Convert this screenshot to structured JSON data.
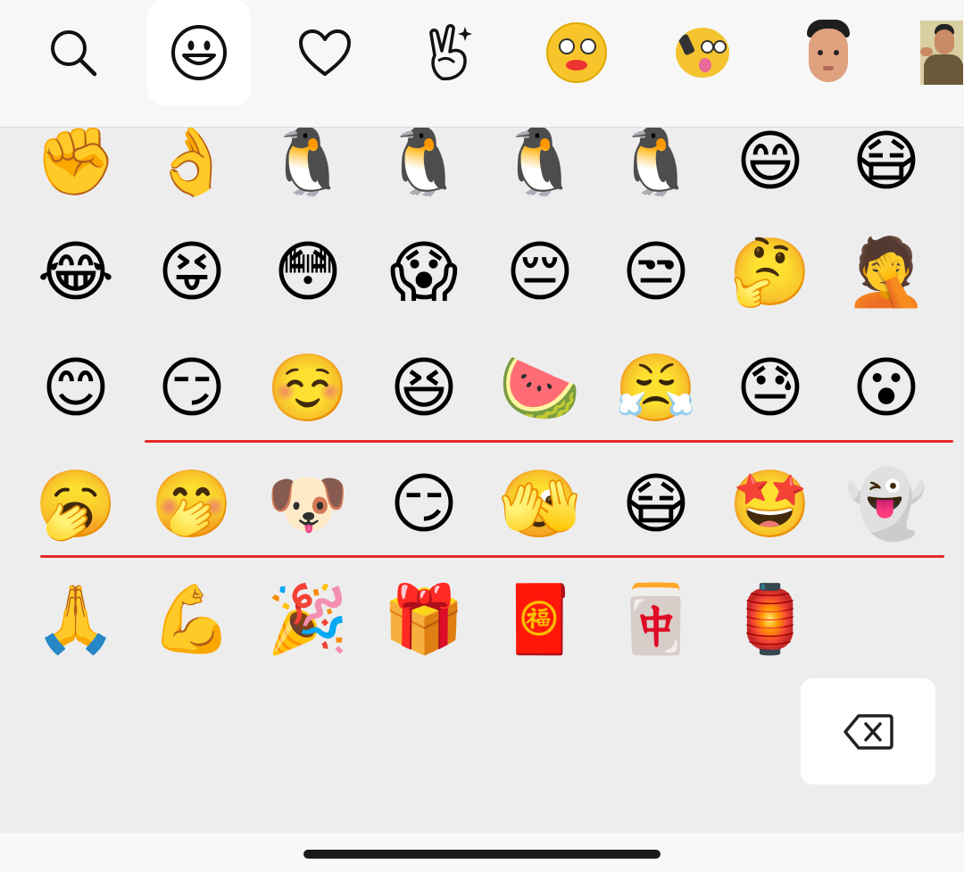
{
  "tabs": [
    {
      "name": "search-tab",
      "icon": "search-icon"
    },
    {
      "name": "emoji-tab",
      "icon": "smiley-icon",
      "active": true
    },
    {
      "name": "favorites-tab",
      "icon": "heart-icon"
    },
    {
      "name": "gesture-tab",
      "icon": "victory-hand-icon"
    },
    {
      "name": "sticker-pack-1-tab",
      "icon": "yellow-face-sticker-icon"
    },
    {
      "name": "sticker-pack-2-tab",
      "icon": "phone-face-sticker-icon"
    },
    {
      "name": "sticker-pack-3-tab",
      "icon": "man-photo-sticker-icon"
    },
    {
      "name": "sticker-pack-4-tab",
      "icon": "man-photo-sticker-icon"
    }
  ],
  "emoji_rows": [
    [
      "✊",
      "👌",
      "🐧",
      "🐧",
      "🐧",
      "🐧",
      "😄",
      "😷"
    ],
    [
      "😂",
      "😝",
      "😳",
      "😱",
      "😔",
      "😒",
      "🤔",
      "🤦"
    ],
    [
      "😊",
      "😏",
      "☺️",
      "😆",
      "🍉",
      "😤",
      "😓",
      "😮"
    ],
    [
      "🥱",
      "🤭",
      "🐶",
      "😏",
      "🫣",
      "😷",
      "🤩",
      "👻"
    ],
    [
      "🙏",
      "💪",
      "🎉",
      "🎁",
      "🧧",
      "🀄",
      "🏮"
    ]
  ],
  "delete_icon": "backspace-icon",
  "colors": {
    "highlight_line": "#e5292b",
    "tabbar": "#f7f7f7",
    "panel": "#ededed"
  }
}
